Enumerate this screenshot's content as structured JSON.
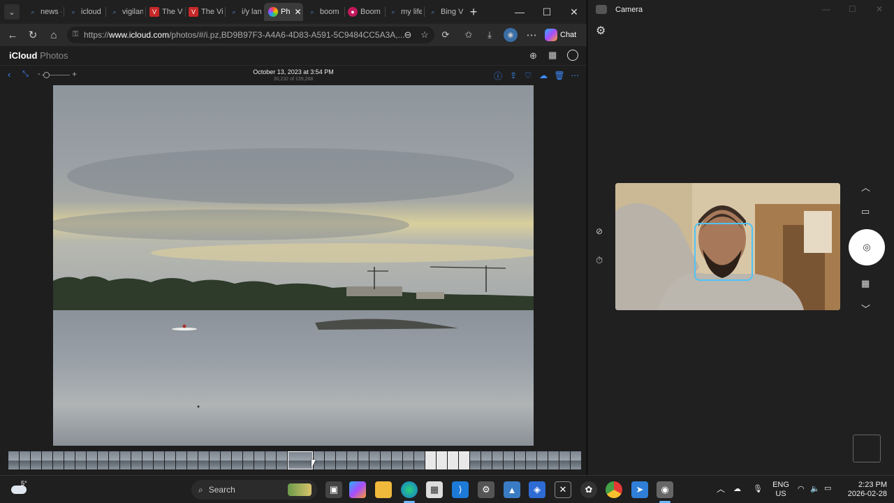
{
  "browser": {
    "tabs": [
      {
        "label": "news -",
        "icon": "search-icon"
      },
      {
        "label": "icloud",
        "icon": "search-icon"
      },
      {
        "label": "vigilan",
        "icon": "search-icon"
      },
      {
        "label": "The Vi",
        "icon": "vice-icon"
      },
      {
        "label": "The Vi",
        "icon": "vice-icon"
      },
      {
        "label": "i/y lan",
        "icon": "search-icon"
      },
      {
        "label": "Ph",
        "icon": "photos-icon",
        "active": true
      },
      {
        "label": "boom",
        "icon": "search-icon"
      },
      {
        "label": "Boom",
        "icon": "boom-icon"
      },
      {
        "label": "my life",
        "icon": "search-icon"
      },
      {
        "label": "Bing V",
        "icon": "search-icon"
      }
    ],
    "url_prefix": "https://",
    "url_domain": "www.icloud.com",
    "url_rest": "/photos/#/i.pz,BD9B97F3-A4A6-4D83-A591-5C9484CC5A3A,...",
    "chat_label": "Chat"
  },
  "icloud": {
    "brand": "iCloud",
    "app": "Photos",
    "photo_date": "October 13, 2023 at 3:54 PM",
    "photo_count": "30,232 of 139,288",
    "zoom_minus": "-",
    "zoom_plus": "+"
  },
  "camera_app": {
    "title": "Camera"
  },
  "taskbar": {
    "weather_temp": "5°",
    "search_placeholder": "Search",
    "lang_top": "ENG",
    "lang_bottom": "US",
    "time": "2:23 PM",
    "date": "2026-02-28"
  },
  "colors": {
    "accent_blue": "#3d8bff",
    "face_box": "#4fc3f7"
  }
}
